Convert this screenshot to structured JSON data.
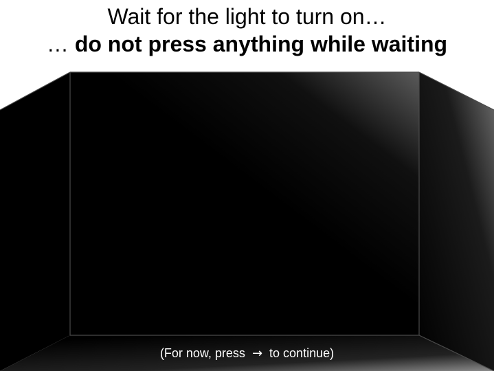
{
  "heading": {
    "line1": "Wait for the light to turn on…",
    "line2_prefix": "… ",
    "line2_bold": "do not press anything while waiting"
  },
  "footer": {
    "prefix": "(For now, press",
    "key_icon": "right-arrow-icon",
    "key_glyph": "→",
    "suffix": "to continue)"
  },
  "colors": {
    "background": "#ffffff",
    "room": "#000000",
    "title_text": "#000000",
    "hint_text": "#ffffff"
  }
}
